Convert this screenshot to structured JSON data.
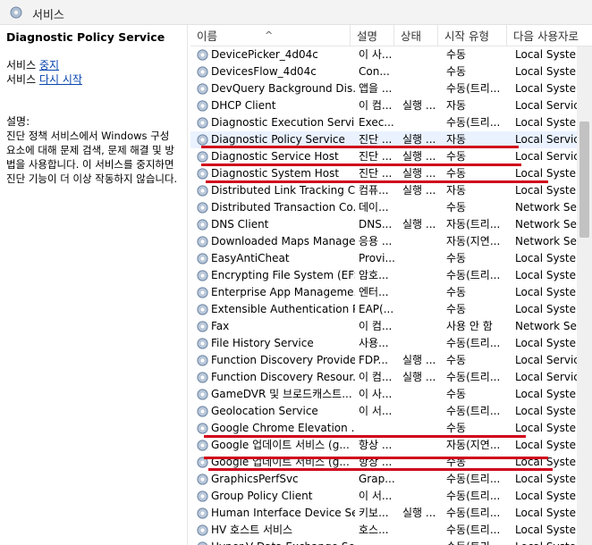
{
  "window": {
    "title": "서비스"
  },
  "left_pane": {
    "service_name": "Diagnostic Policy Service",
    "action_prefix": "서비스",
    "actions": [
      "중지",
      "다시 시작"
    ],
    "description_label": "설명:",
    "description": "진단 정책 서비스에서 Windows 구성 요소에 대해 문제 검색, 문제 해결 및 방법을 사용합니다. 이 서비스를 중지하면 진단 기능이 더 이상 작동하지 않습니다."
  },
  "columns": [
    "이름",
    "설명",
    "상태",
    "시작 유형",
    "다음 사용자로"
  ],
  "sort_indicator": "^",
  "services": [
    {
      "name": "DevicePicker_4d04c",
      "desc": "이 사...",
      "status": "",
      "startup": "수동",
      "logon": "Local System"
    },
    {
      "name": "DevicesFlow_4d04c",
      "desc": "Con...",
      "status": "",
      "startup": "수동",
      "logon": "Local System"
    },
    {
      "name": "DevQuery Background Dis...",
      "desc": "앱을 ...",
      "status": "",
      "startup": "수동(트리...",
      "logon": "Local System"
    },
    {
      "name": "DHCP Client",
      "desc": "이 컴...",
      "status": "실행 ...",
      "startup": "자동",
      "logon": "Local Service"
    },
    {
      "name": "Diagnostic Execution Service",
      "desc": "Exec...",
      "status": "",
      "startup": "수동(트리...",
      "logon": "Local System"
    },
    {
      "name": "Diagnostic Policy Service",
      "desc": "진단 ...",
      "status": "실행 ...",
      "startup": "자동",
      "logon": "Local Service"
    },
    {
      "name": "Diagnostic Service Host",
      "desc": "진단 ...",
      "status": "실행 ...",
      "startup": "수동",
      "logon": "Local Service"
    },
    {
      "name": "Diagnostic System Host",
      "desc": "진단 ...",
      "status": "실행 ...",
      "startup": "수동",
      "logon": "Local System"
    },
    {
      "name": "Distributed Link Tracking C...",
      "desc": "컴퓨...",
      "status": "실행 ...",
      "startup": "자동",
      "logon": "Local System"
    },
    {
      "name": "Distributed Transaction Co...",
      "desc": "데이...",
      "status": "",
      "startup": "수동",
      "logon": "Network Service"
    },
    {
      "name": "DNS Client",
      "desc": "DNS...",
      "status": "실행 ...",
      "startup": "자동(트리...",
      "logon": "Network Service"
    },
    {
      "name": "Downloaded Maps Manager",
      "desc": "응용 ...",
      "status": "",
      "startup": "자동(지연...",
      "logon": "Network Service"
    },
    {
      "name": "EasyAntiCheat",
      "desc": "Provi...",
      "status": "",
      "startup": "수동",
      "logon": "Local System"
    },
    {
      "name": "Encrypting File System (EFS)",
      "desc": "암호...",
      "status": "",
      "startup": "수동(트리...",
      "logon": "Local System"
    },
    {
      "name": "Enterprise App Manageme...",
      "desc": "엔터...",
      "status": "",
      "startup": "수동",
      "logon": "Local System"
    },
    {
      "name": "Extensible Authentication P...",
      "desc": "EAP(...",
      "status": "",
      "startup": "수동",
      "logon": "Local System"
    },
    {
      "name": "Fax",
      "desc": "이 컴...",
      "status": "",
      "startup": "사용 안 함",
      "logon": "Network Service"
    },
    {
      "name": "File History Service",
      "desc": "사용...",
      "status": "",
      "startup": "수동(트리...",
      "logon": "Local System"
    },
    {
      "name": "Function Discovery Provide...",
      "desc": "FDP...",
      "status": "실행 ...",
      "startup": "수동",
      "logon": "Local Service"
    },
    {
      "name": "Function Discovery Resour...",
      "desc": "이 컴...",
      "status": "실행 ...",
      "startup": "수동(트리...",
      "logon": "Local Service"
    },
    {
      "name": "GameDVR 및 브로드캐스트...",
      "desc": "이 사...",
      "status": "",
      "startup": "수동",
      "logon": "Local System"
    },
    {
      "name": "Geolocation Service",
      "desc": "이 서...",
      "status": "",
      "startup": "수동(트리...",
      "logon": "Local System"
    },
    {
      "name": "Google Chrome Elevation ...",
      "desc": "",
      "status": "",
      "startup": "수동",
      "logon": "Local System"
    },
    {
      "name": "Google 업데이트 서비스 (g...",
      "desc": "항상 ...",
      "status": "",
      "startup": "자동(지연...",
      "logon": "Local System"
    },
    {
      "name": "Google 업데이트 서비스 (g...",
      "desc": "항상 ...",
      "status": "",
      "startup": "수동",
      "logon": "Local System"
    },
    {
      "name": "GraphicsPerfSvc",
      "desc": "Grap...",
      "status": "",
      "startup": "수동(트리...",
      "logon": "Local System"
    },
    {
      "name": "Group Policy Client",
      "desc": "이 서...",
      "status": "",
      "startup": "수동(트리...",
      "logon": "Local System"
    },
    {
      "name": "Human Interface Device Se...",
      "desc": "키보...",
      "status": "실행 ...",
      "startup": "수동(트리...",
      "logon": "Local System"
    },
    {
      "name": "HV 호스트 서비스",
      "desc": "호스...",
      "status": "",
      "startup": "수동(트리...",
      "logon": "Local System"
    },
    {
      "name": "Hyper-V Data Exchange Se...",
      "desc": "...",
      "status": "",
      "startup": "수동(트리...",
      "logon": "Local System"
    }
  ],
  "selected_service": "Diagnostic Policy Service",
  "colors": {
    "accent_red": "#d0021b",
    "link": "#0645ad",
    "selected_row": "#eaf2ff"
  },
  "icons": {
    "window": "gear-icon",
    "service": "gear-icon"
  }
}
